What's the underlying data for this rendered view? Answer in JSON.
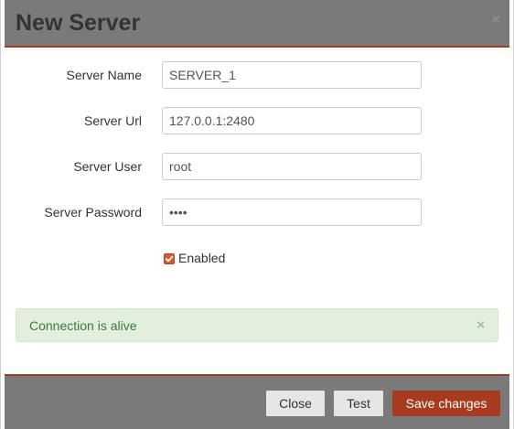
{
  "dialog": {
    "title": "New Server",
    "close_symbol": "×"
  },
  "form": {
    "server_name": {
      "label": "Server Name",
      "value": "SERVER_1"
    },
    "server_url": {
      "label": "Server Url",
      "value": "127.0.0.1:2480"
    },
    "server_user": {
      "label": "Server User",
      "value": "root"
    },
    "server_password": {
      "label": "Server Password",
      "value": "root"
    },
    "enabled": {
      "label": "Enabled",
      "checked": true
    }
  },
  "alert": {
    "text": "Connection is alive",
    "close_symbol": "×"
  },
  "footer": {
    "close_label": "Close",
    "test_label": "Test",
    "save_label": "Save changes"
  },
  "colors": {
    "header_bg": "#7a7a7a",
    "accent": "#a73a1f",
    "alert_bg": "#e1efdc",
    "alert_text": "#3d7a3d"
  }
}
